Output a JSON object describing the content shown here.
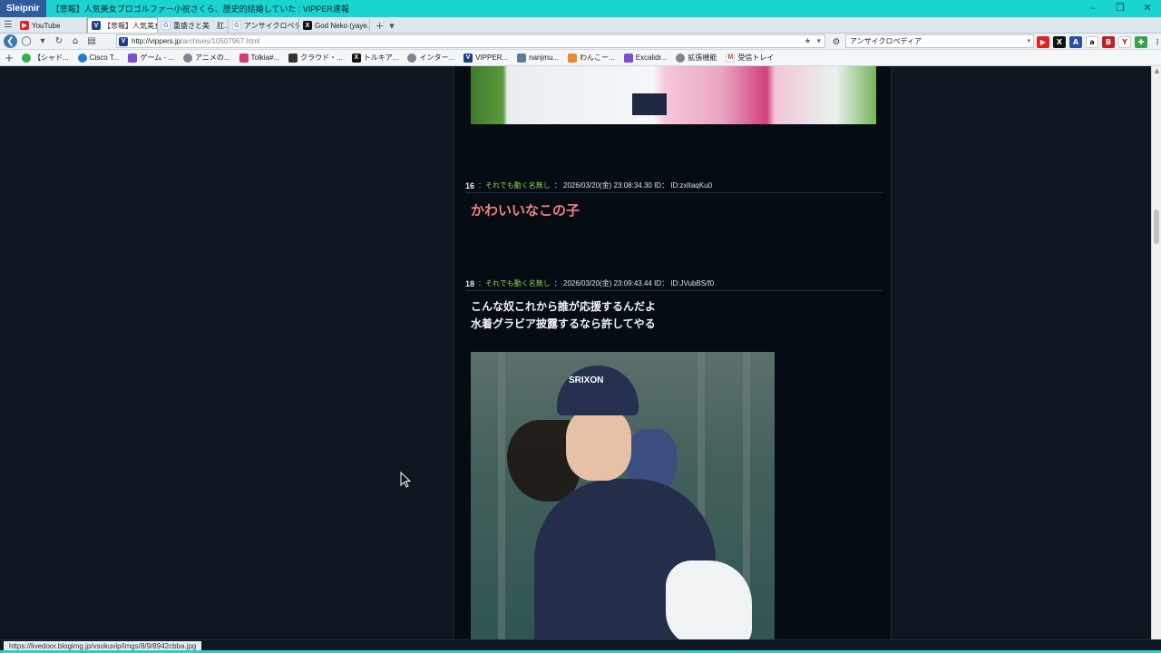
{
  "titlebar": {
    "app_name": "Sleipnir",
    "title": "【悲報】人気美女プロゴルファー小祝さくら、歴史的結婚していた : VIPPER速報",
    "controls": [
      "–",
      "❐",
      "✕"
    ]
  },
  "tabs": [
    {
      "label": "YouTube",
      "icon": "yt",
      "active": false
    },
    {
      "label": "【悲報】人気美女...",
      "icon": "v",
      "active": true
    },
    {
      "label": "重盛さと美　肛...",
      "icon": "g",
      "active": false
    },
    {
      "label": "アンサイクロペディ...",
      "icon": "g",
      "active": false
    },
    {
      "label": "God Neko (yaye...",
      "icon": "x",
      "active": false
    }
  ],
  "navbar": {
    "url_host": "http://vippers.jp",
    "url_path": "/archives/10507967.html",
    "search_text": "アンサイクロペディア"
  },
  "bookmarks": [
    {
      "label": "【シャド...",
      "icon": "green"
    },
    {
      "label": "Cisco T...",
      "icon": "blue"
    },
    {
      "label": "ゲーム - ...",
      "icon": "purple"
    },
    {
      "label": "アニメの...",
      "icon": "gray"
    },
    {
      "label": "Tolkia#...",
      "icon": "pink"
    },
    {
      "label": "クラウド・...",
      "icon": "sic"
    },
    {
      "label": "トルキア...",
      "icon": "x"
    },
    {
      "label": "インター...",
      "icon": "gray"
    },
    {
      "label": "VIPPER...",
      "icon": "v"
    },
    {
      "label": "nanjmu...",
      "icon": "w"
    },
    {
      "label": "わんこー...",
      "icon": "orange"
    },
    {
      "label": "Excalidr...",
      "icon": "purple"
    },
    {
      "label": "拡張機能",
      "icon": "gray"
    },
    {
      "label": "受信トレイ",
      "icon": "gm"
    }
  ],
  "posts": [
    {
      "number": "16",
      "name": "：それでも動く名無し",
      "meta": "： 2026/03/20(金) 23:08:34.30 ID： ID:zxItaqKu0",
      "body": [
        "かわいいなこの子"
      ]
    },
    {
      "number": "18",
      "name": "：それでも動く名無し",
      "meta": "： 2026/03/20(金) 23:09:43.44 ID： ID:JVubBS/f0",
      "body": [
        "こんな奴これから誰が応援するんだよ",
        "水着グラビア披露するなら許してやる"
      ]
    }
  ],
  "image": {
    "cap_text": "SRIXON"
  },
  "status": {
    "hover_url": "https://livedoor.blogimg.jp/vsokuvip/imgs/8/9/8942cbba.jpg"
  }
}
